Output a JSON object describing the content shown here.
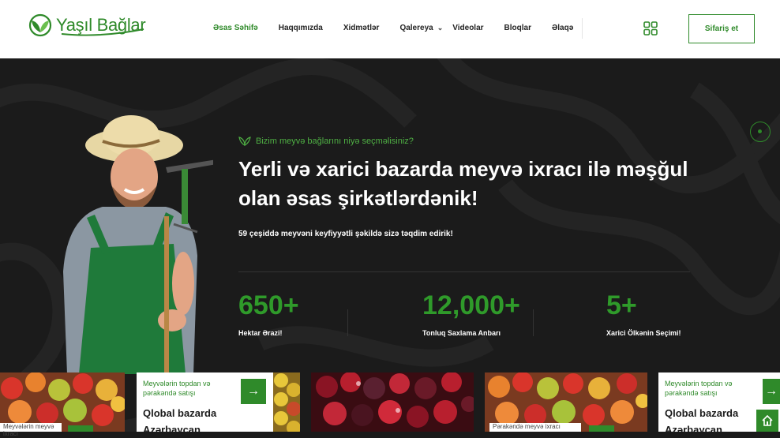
{
  "header": {
    "brand": "Yaşıl Bağlar",
    "nav": [
      {
        "label": "Əsas Səhifə",
        "active": true
      },
      {
        "label": "Haqqımızda"
      },
      {
        "label": "Xidmətlər"
      },
      {
        "label": "Qalereya",
        "caret": "⌄"
      },
      {
        "label": "Videolar"
      },
      {
        "label": "Bloqlar"
      },
      {
        "label": "Əlaqə"
      }
    ],
    "order_button": "Sifariş et"
  },
  "hero": {
    "eyebrow": "Bizim meyvə bağlarını niyə seçməlisiniz?",
    "headline": "Yerli və xarici bazarda meyvə ixracı ilə məşğul olan əsas şirkətlərdənik!",
    "subtitle": "59 çeşiddə meyvəni keyfiyyətli şəkildə sizə təqdim edirik!",
    "stats": [
      {
        "value": "650+",
        "label": "Hektar Ərazi!"
      },
      {
        "value": "12,000+",
        "label": "Tonluq Saxlama Anbarı"
      },
      {
        "value": "5+",
        "label": "Xarici Ölkənin Seçimi!"
      }
    ]
  },
  "cards": [
    {
      "text": "Meyvələrin topdan və pərakəndə satışı",
      "title": "Qlobal bazarda Azərbaycan",
      "arrow": "→"
    },
    {
      "text": "Meyvələrin topdan və pərakəndə satışı",
      "title": "Qlobal bazarda Azərbaycan",
      "arrow": "→"
    }
  ],
  "strips": [
    "Meyvələrin meyvə ixracı",
    "Pərakəndə meyvə ixracı"
  ],
  "colors": {
    "brand_green": "#2f8a2a",
    "dark_bg": "#1b1b1b"
  }
}
